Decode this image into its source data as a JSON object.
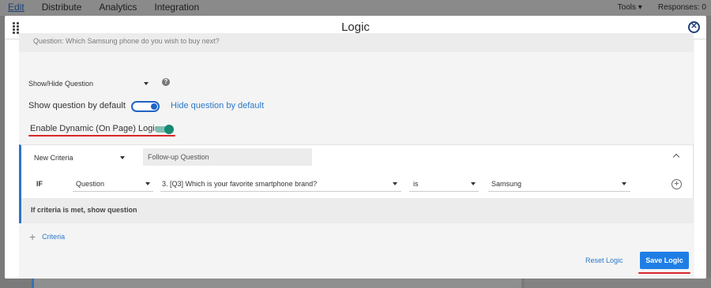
{
  "app_nav": {
    "tabs": [
      "Edit",
      "Distribute",
      "Analytics",
      "Integration"
    ],
    "tools_label": "Tools",
    "responses_label": "Responses: 0"
  },
  "modal": {
    "title": "Logic",
    "question_text": "Question: Which Samsung phone do you wish to buy next?",
    "action_select": "Show/Hide Question",
    "show_default_label": "Show question by default",
    "hide_default_label": "Hide question by default",
    "show_default_on": true,
    "dynamic_logic_label": "Enable Dynamic (On Page) Logic",
    "dynamic_logic_on": true
  },
  "criteria": {
    "type_select": "New Criteria",
    "followup_value": "Follow-up Question",
    "if_label": "IF",
    "source_select": "Question",
    "question_select": "3. [Q3] Which is your favorite smartphone brand?",
    "operator_select": "is",
    "value_select": "Samsung",
    "footer_text": "If criteria is met, show question",
    "add_label": "Criteria"
  },
  "footer": {
    "reset_label": "Reset Logic",
    "save_label": "Save Logic"
  },
  "colors": {
    "primary": "#1f7ee6",
    "link": "#2b78c9",
    "highlight": "#d9262b",
    "toggle_green": "#168a73"
  }
}
